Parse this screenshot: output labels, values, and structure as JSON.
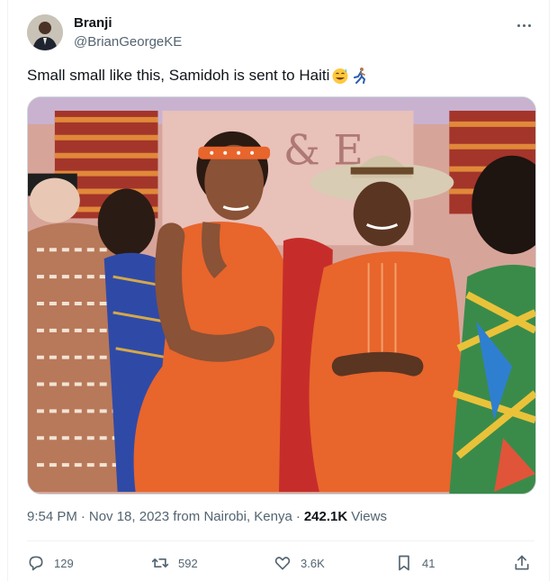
{
  "author": {
    "display_name": "Branji",
    "handle": "@BrianGeorgeKE"
  },
  "tweet": {
    "text": "Small small like this, Samidoh is sent to Haiti",
    "emojis": [
      "sweat-smile-emoji",
      "running-man-emoji"
    ]
  },
  "meta": {
    "time": "9:54 PM",
    "sep1": "·",
    "date": "Nov 18, 2023 from Nairobi, Kenya",
    "sep2": "·",
    "views_count": "242.1K",
    "views_label": "Views"
  },
  "actions": {
    "reply_count": "129",
    "retweet_count": "592",
    "like_count": "3.6K",
    "bookmark_count": "41"
  },
  "colors": {
    "text_primary": "#0f1419",
    "text_secondary": "#536471",
    "border": "#cfd9de",
    "outfit_orange": "#e8652c"
  }
}
